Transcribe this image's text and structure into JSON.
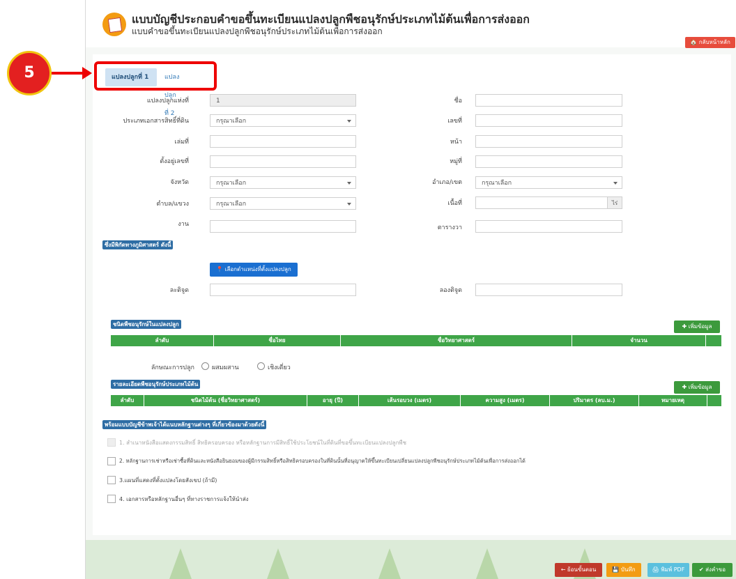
{
  "marker": {
    "number": "5"
  },
  "header": {
    "title": "แบบบัญชีประกอบคำขอขึ้นทะเบียนแปลงปลูกพืชอนุรักษ์ประเภทไม้ต้นเพื่อการส่งออก",
    "subtitle": "แบบคำขอขึ้นทะเบียนแปลงปลูกพืชอนุรักษ์ประเภทไม้ต้นเพื่อการส่งออก",
    "home_label": "🏠 กลับหน้าหลัก"
  },
  "tabs": [
    {
      "label": "แปลงปลูกที่ 1"
    },
    {
      "label": "แปลงปลูกที่ 2"
    }
  ],
  "form": {
    "plot_no": {
      "label": "แปลงปลูกแห่งที่",
      "value": "1"
    },
    "name": {
      "label": "ชื่อ",
      "value": ""
    },
    "doc_type": {
      "label": "ประเภทเอกสารสิทธิ์ที่ดิน",
      "value": "กรุณาเลือก"
    },
    "doc_no": {
      "label": "เลขที่",
      "value": ""
    },
    "book": {
      "label": "เล่มที่",
      "value": ""
    },
    "page": {
      "label": "หน้า",
      "value": ""
    },
    "house_no": {
      "label": "ตั้งอยู่เลขที่",
      "value": ""
    },
    "moo": {
      "label": "หมู่ที่",
      "value": ""
    },
    "province": {
      "label": "จังหวัด",
      "value": "กรุณาเลือก"
    },
    "district": {
      "label": "อำเภอ/เขต",
      "value": "กรุณาเลือก"
    },
    "subdistrict": {
      "label": "ตำบล/แขวง",
      "value": "กรุณาเลือก"
    },
    "area": {
      "label": "เนื้อที่",
      "value": "",
      "unit": "ไร่"
    },
    "ngan": {
      "label": "งาน",
      "value": ""
    },
    "sqwa": {
      "label": "ตารางวา",
      "value": ""
    }
  },
  "geo": {
    "section": "ซึ่งมีพิกัดทางภูมิศาสตร์ ดังนี้",
    "pick_button": "📍 เลือกตำแหน่งที่ตั้งแปลงปลูก",
    "lat_label": "ละติจูด",
    "lng_label": "ลองติจูด"
  },
  "plants": {
    "section": "ชนิดพืชอนุรักษ์ในแปลงปลูก",
    "add_button": "✚ เพิ่มข้อมูล",
    "columns": [
      "ลำดับ",
      "ชื่อไทย",
      "ชื่อวิทยาศาสตร์",
      "จำนวน"
    ]
  },
  "planting": {
    "label": "ลักษณะการปลูก",
    "options": [
      "ผสมผสาน",
      "เชิงเดี่ยว"
    ]
  },
  "trees": {
    "section": "รายละเอียดพืชอนุรักษ์ประเภทไม้ต้น",
    "add_button": "✚ เพิ่มข้อมูล",
    "columns": [
      "ลำดับ",
      "ชนิดไม้ต้น (ชื่อวิทยาศาสตร์)",
      "อายุ (ปี)",
      "เส้นรอบวง (เมตร)",
      "ความสูง (เมตร)",
      "ปริมาตร (ลบ.ม.)",
      "หมายเหตุ"
    ]
  },
  "attachments": {
    "section": "พร้อมแบบบัญชีข้าพเจ้าได้แนบหลักฐานต่างๆ ที่เกี่ยวข้องมาด้วยดังนี้",
    "items": [
      "1. สำเนาหนังสือแสดงกรรมสิทธิ์ สิทธิครอบครอง หรือหลักฐานการมีสิทธิ์ใช้ประโยชน์ในที่ดินที่ขอขึ้นทะเบียนแปลงปลูกพืช",
      "2. หลักฐานการเช่าหรือเช่าซื้อที่ดินและหนังสือยินยอมของผู้มีกรรมสิทธิ์หรือสิทธิครอบครองในที่ดินนั้นที่อนุญาตให้ขึ้นทะเบียนเปลี่ยนแปลงปลูกพืชอนุรักษ์ประเภทไม้ต้นเพื่อการส่งออกได้",
      "3.แผนที่แสดงที่ตั้งแปลงโดยสังเขป (ถ้ามี)",
      "4. เอกสารหรือหลักฐานอื่นๆ ที่ทางราชการแจ้งให้นำส่ง"
    ]
  },
  "footer": {
    "back": "← ย้อนขั้นตอน",
    "save": "💾 บันทึก",
    "pdf": "🖨 พิมพ์ PDF",
    "submit": "✔ ส่งคำขอ"
  },
  "colors": {
    "green": "#3fa548",
    "blue": "#2e6da4",
    "red": "#e74c3c",
    "orange": "#f39c12"
  }
}
